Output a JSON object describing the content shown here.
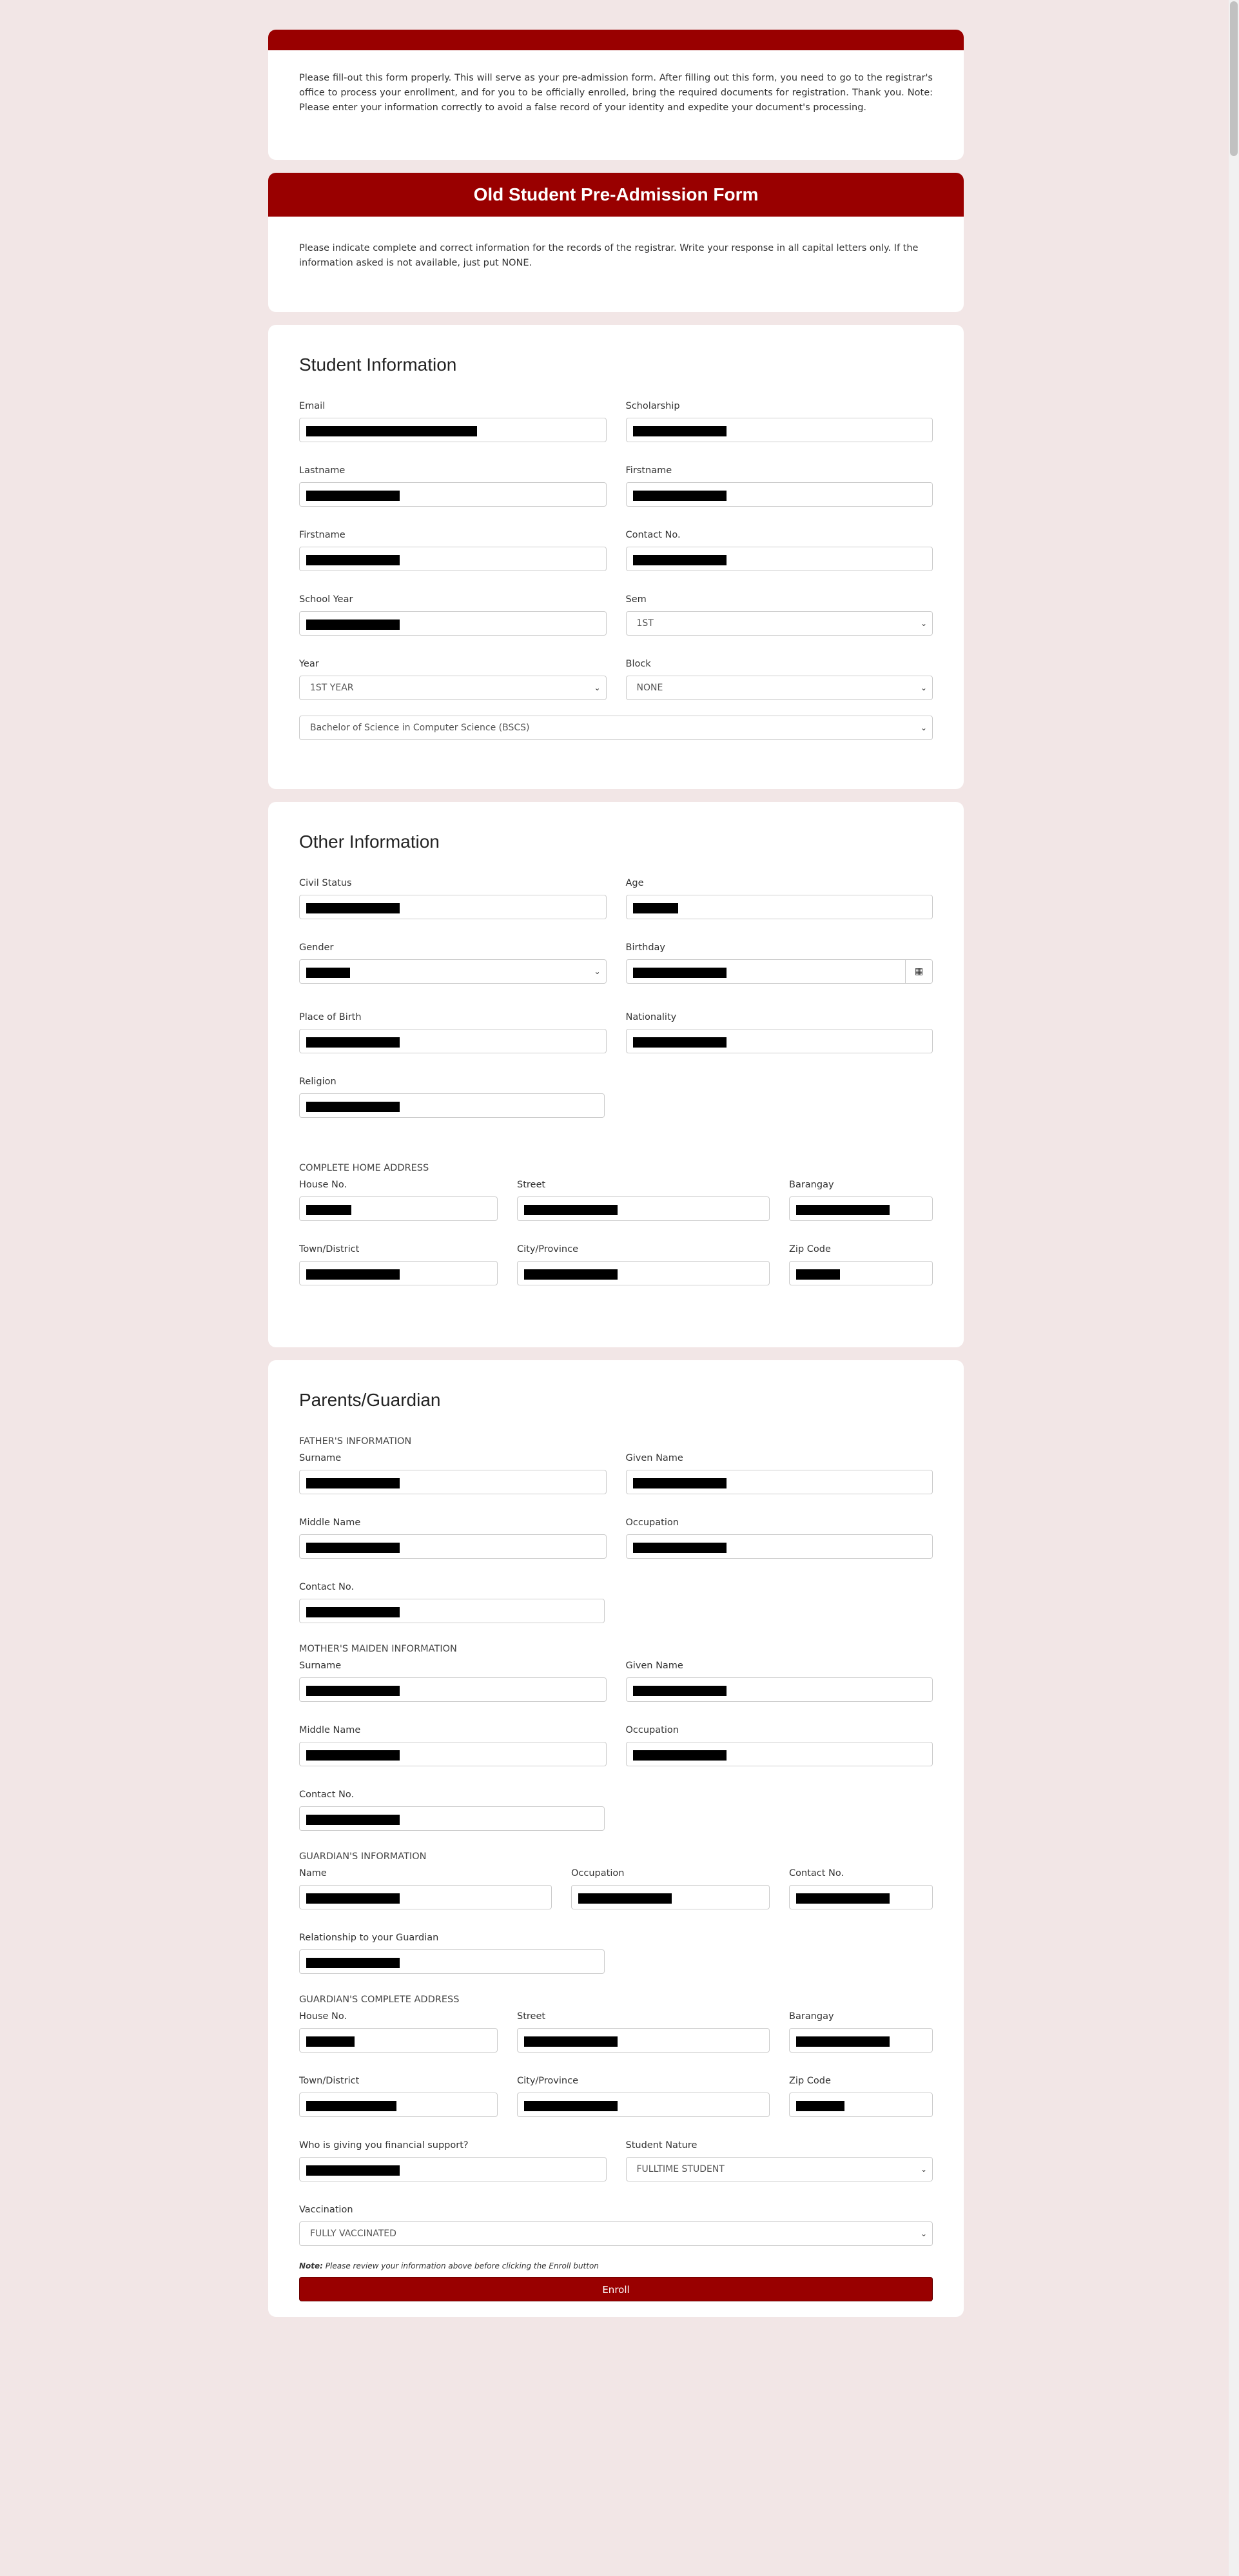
{
  "intro": {
    "text": "Please fill-out this form properly. This will serve as your pre-admission form. After filling out this form, you need to go to the registrar's office to process your enrollment, and for you to be officially enrolled, bring the required documents for registration. Thank you. Note: Please enter your information correctly to avoid a false record of your identity and expedite your document's processing."
  },
  "form": {
    "title": "Old Student Pre-Admission Form",
    "description": "Please indicate complete and correct information for the records of the registrar. Write your response in all capital letters only. If the information asked is not available, just put NONE."
  },
  "student": {
    "title": "Student Information",
    "email": "Email",
    "scholarship": "Scholarship",
    "lastname": "Lastname",
    "firstname": "Firstname",
    "firstname2": "Firstname",
    "contact": "Contact No.",
    "school_year": "School Year",
    "sem": "Sem",
    "sem_value": "1ST",
    "year": "Year",
    "year_value": "1ST YEAR",
    "block": "Block",
    "block_value": "NONE",
    "course_value": "Bachelor of Science in Computer Science (BSCS)"
  },
  "other": {
    "title": "Other Information",
    "civil_status": "Civil Status",
    "age": "Age",
    "gender": "Gender",
    "birthday": "Birthday",
    "place_of_birth": "Place of Birth",
    "nationality": "Nationality",
    "religion": "Religion",
    "address_label": "COMPLETE HOME ADDRESS",
    "house_no": "House No.",
    "street": "Street",
    "barangay": "Barangay",
    "town": "Town/District",
    "city": "City/Province",
    "zip": "Zip Code"
  },
  "parents": {
    "title": "Parents/Guardian",
    "father_label": "FATHER'S INFORMATION",
    "mother_label": "MOTHER'S MAIDEN INFORMATION",
    "guardian_label": "GUARDIAN'S INFORMATION",
    "guardian_address_label": "GUARDIAN'S COMPLETE ADDRESS",
    "surname": "Surname",
    "given_name": "Given Name",
    "middle_name": "Middle Name",
    "occupation": "Occupation",
    "contact": "Contact No.",
    "name": "Name",
    "relationship": "Relationship to your Guardian",
    "house_no": "House No.",
    "street": "Street",
    "barangay": "Barangay",
    "town": "Town/District",
    "city": "City/Province",
    "zip": "Zip Code",
    "financial": "Who is giving you financial support?",
    "student_nature": "Student Nature",
    "student_nature_value": "FULLTIME STUDENT",
    "vaccination": "Vaccination",
    "vaccination_value": "FULLY VACCINATED"
  },
  "footer": {
    "note_bold": "Note:",
    "note_text": " Please review your information above before clicking the Enroll button",
    "enroll": "Enroll"
  }
}
